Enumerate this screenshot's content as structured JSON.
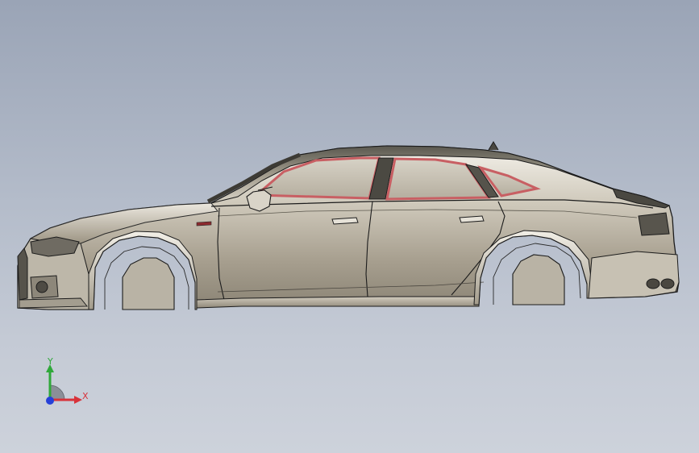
{
  "viewport": {
    "background_top": "#9aa4b6",
    "background_bottom": "#cdd2db"
  },
  "model": {
    "name": "car-body",
    "body_color": "#c9c3b4",
    "window_trim_color": "#c85f63",
    "edge_color": "#1c1c1c"
  },
  "triad": {
    "x_label": "X",
    "y_label": "Y",
    "x_color": "#d8323a",
    "y_color": "#2fa83a",
    "z_color": "#2640d8"
  }
}
